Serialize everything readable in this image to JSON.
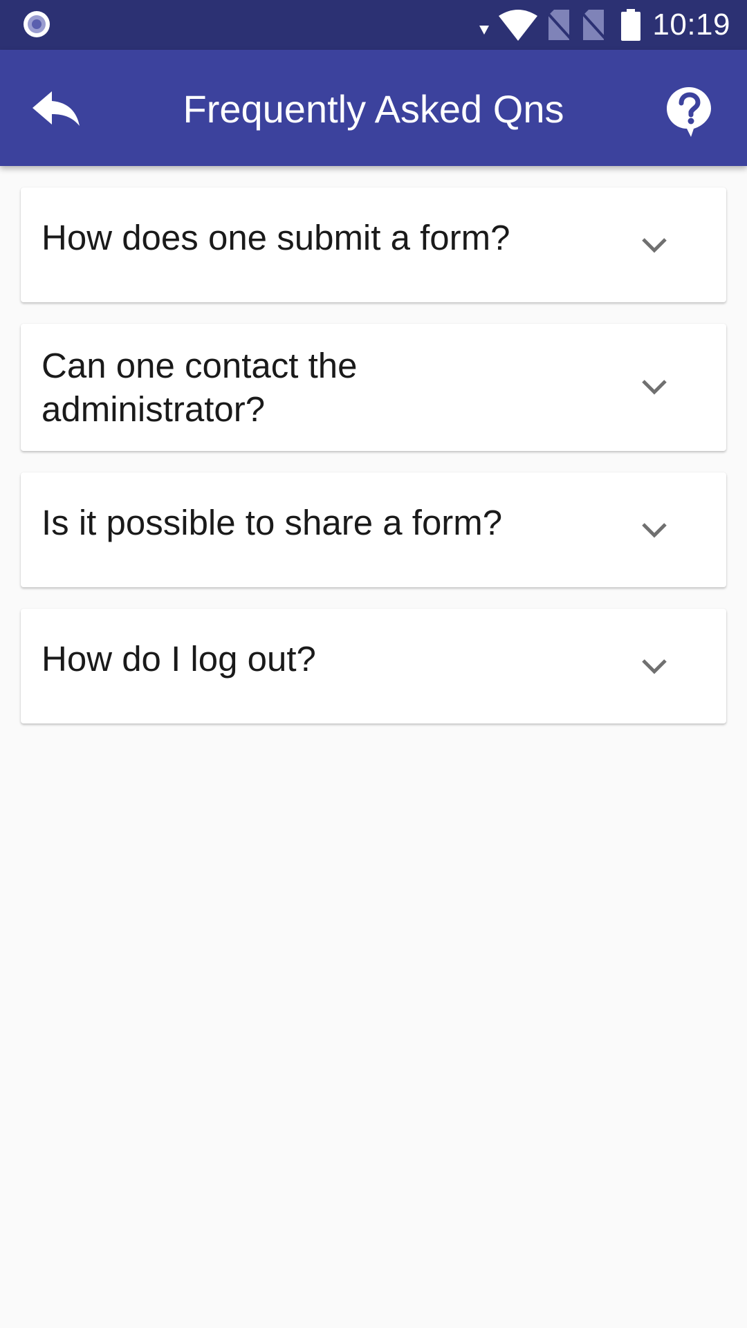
{
  "status_bar": {
    "time": "10:19",
    "icons": [
      "record-icon",
      "data-arrow-icon",
      "wifi-icon",
      "no-sim-icon",
      "no-sim-icon",
      "battery-icon"
    ]
  },
  "app_bar": {
    "title": "Frequently Asked Qns",
    "back_icon": "reply-arrow-icon",
    "help_icon": "help-bubble-icon"
  },
  "faq": {
    "items": [
      {
        "question": "How does one submit a form?",
        "icon": "chevron-down-icon"
      },
      {
        "question": "Can one contact the administrator?",
        "icon": "chevron-down-icon"
      },
      {
        "question": "Is it possible to share a form?",
        "icon": "chevron-down-icon"
      },
      {
        "question": "How do I log out?",
        "icon": "chevron-down-icon"
      }
    ]
  },
  "colors": {
    "status_bar": "#2c3173",
    "app_bar": "#3c429d",
    "background": "#fafafa",
    "card": "#ffffff",
    "text": "#1a1a1a",
    "chevron": "#707070"
  }
}
